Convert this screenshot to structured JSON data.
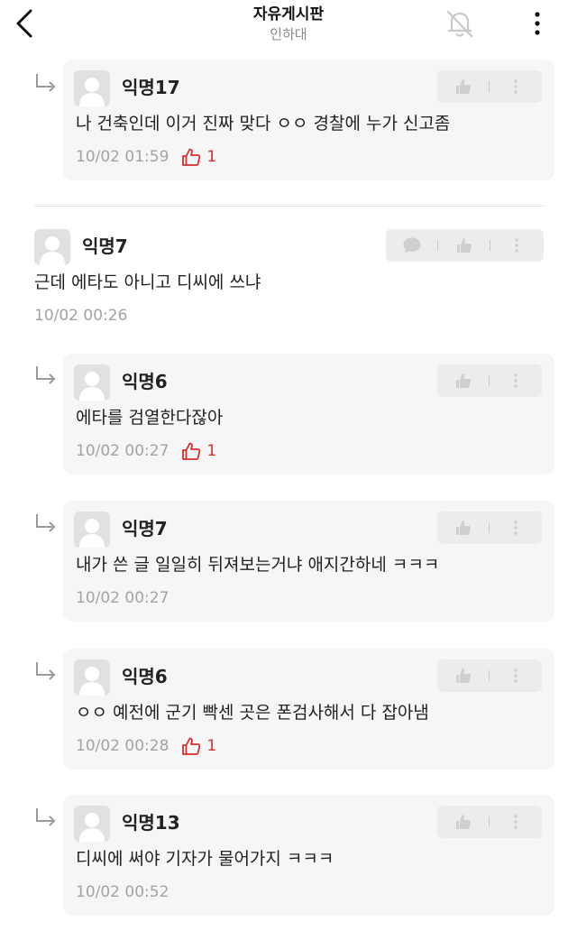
{
  "header": {
    "title": "자유게시판",
    "subtitle": "인하대"
  },
  "icons": {
    "back": "chevron-left-icon",
    "bell": "bell-off-icon",
    "more": "more-vertical-icon",
    "reply": "reply-arrow-icon",
    "comment": "comment-icon",
    "like": "thumbs-up-icon",
    "menu": "more-vertical-icon"
  },
  "colors": {
    "vote": "#d32f2f",
    "card_bg": "#f6f6f6",
    "meta": "#a3a3a3"
  },
  "parent_comment": {
    "nickname": "익명7",
    "text": "근데 에타도 아니고 디씨에 쓰냐",
    "time": "10/02 00:26"
  },
  "replies": [
    {
      "nickname": "익명17",
      "text": "나 건축인데 이거 진짜 맞다 ㅇㅇ 경찰에 누가 신고좀",
      "time": "10/02 01:59",
      "votes": "1"
    },
    {
      "nickname": "익명6",
      "text": "에타를 검열한다잖아",
      "time": "10/02 00:27",
      "votes": "1"
    },
    {
      "nickname": "익명7",
      "text": "내가 쓴 글 일일히 뒤져보는거냐 애지간하네 ㅋㅋㅋ",
      "time": "10/02 00:27",
      "votes": ""
    },
    {
      "nickname": "익명6",
      "text": "ㅇㅇ 예전에 군기 빡센 곳은 폰검사해서 다 잡아냄",
      "time": "10/02 00:28",
      "votes": "1"
    },
    {
      "nickname": "익명13",
      "text": "디씨에 써야 기자가 물어가지 ㅋㅋㅋ",
      "time": "10/02 00:52",
      "votes": ""
    }
  ]
}
